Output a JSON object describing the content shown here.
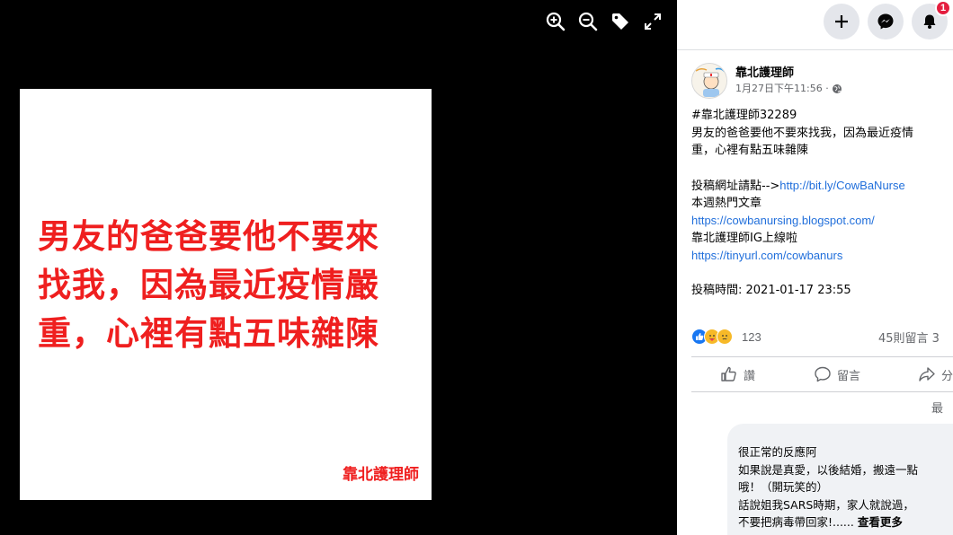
{
  "viewer": {
    "tools": [
      "zoom-in-icon",
      "zoom-out-icon",
      "tag-icon",
      "fullscreen-icon"
    ],
    "photo": {
      "lines": [
        "男友的爸爸要他不要來",
        "找我，因為最近疫情嚴",
        "重，心裡有點五味雜陳"
      ],
      "signature": "靠北護理師"
    }
  },
  "topbar": {
    "buttons": [
      "plus-icon",
      "messenger-icon",
      "bell-icon"
    ],
    "notification_badge": "1"
  },
  "post": {
    "author": "靠北護理師",
    "timestamp": "1月27日下午11:56 ·",
    "body": {
      "hashtag": "#靠北護理師32289",
      "line1": "男友的爸爸要他不要來找我，因為最近疫情",
      "line2": "重，心裡有點五味雜陳",
      "submit_prefix": "投稿網址請點-->",
      "submit_link": "http://bit.ly/CowBaNurse",
      "popular_label": "本週熱門文章",
      "popular_link": "https://cowbanursing.blogspot.com/",
      "ig_label": "靠北護理師IG上線啦",
      "ig_link": "https://tinyurl.com/cowbanurs",
      "submit_time": "投稿時間: 2021-01-17 23:55"
    },
    "reactions": {
      "icons": [
        "like-icon",
        "care-icon",
        "sad-icon"
      ],
      "count": "123",
      "comments": "45則留言 3"
    },
    "actions": {
      "like": "讚",
      "comment": "留言",
      "share": "分"
    },
    "sort_label": "最",
    "comment": {
      "lines": [
        "很正常的反應阿",
        "如果說是真愛，以後結婚，搬遠一點",
        "哦！（開玩笑的）",
        "話說姐我SARS時期，家人就說過，"
      ],
      "last_line": "不要把病毒帶回家!......",
      "see_more": "查看更多"
    }
  },
  "colors": {
    "photo_text": "#ef1f1f",
    "link": "#216fdb",
    "badge": "#e41e3f",
    "like": "#1877f2"
  }
}
